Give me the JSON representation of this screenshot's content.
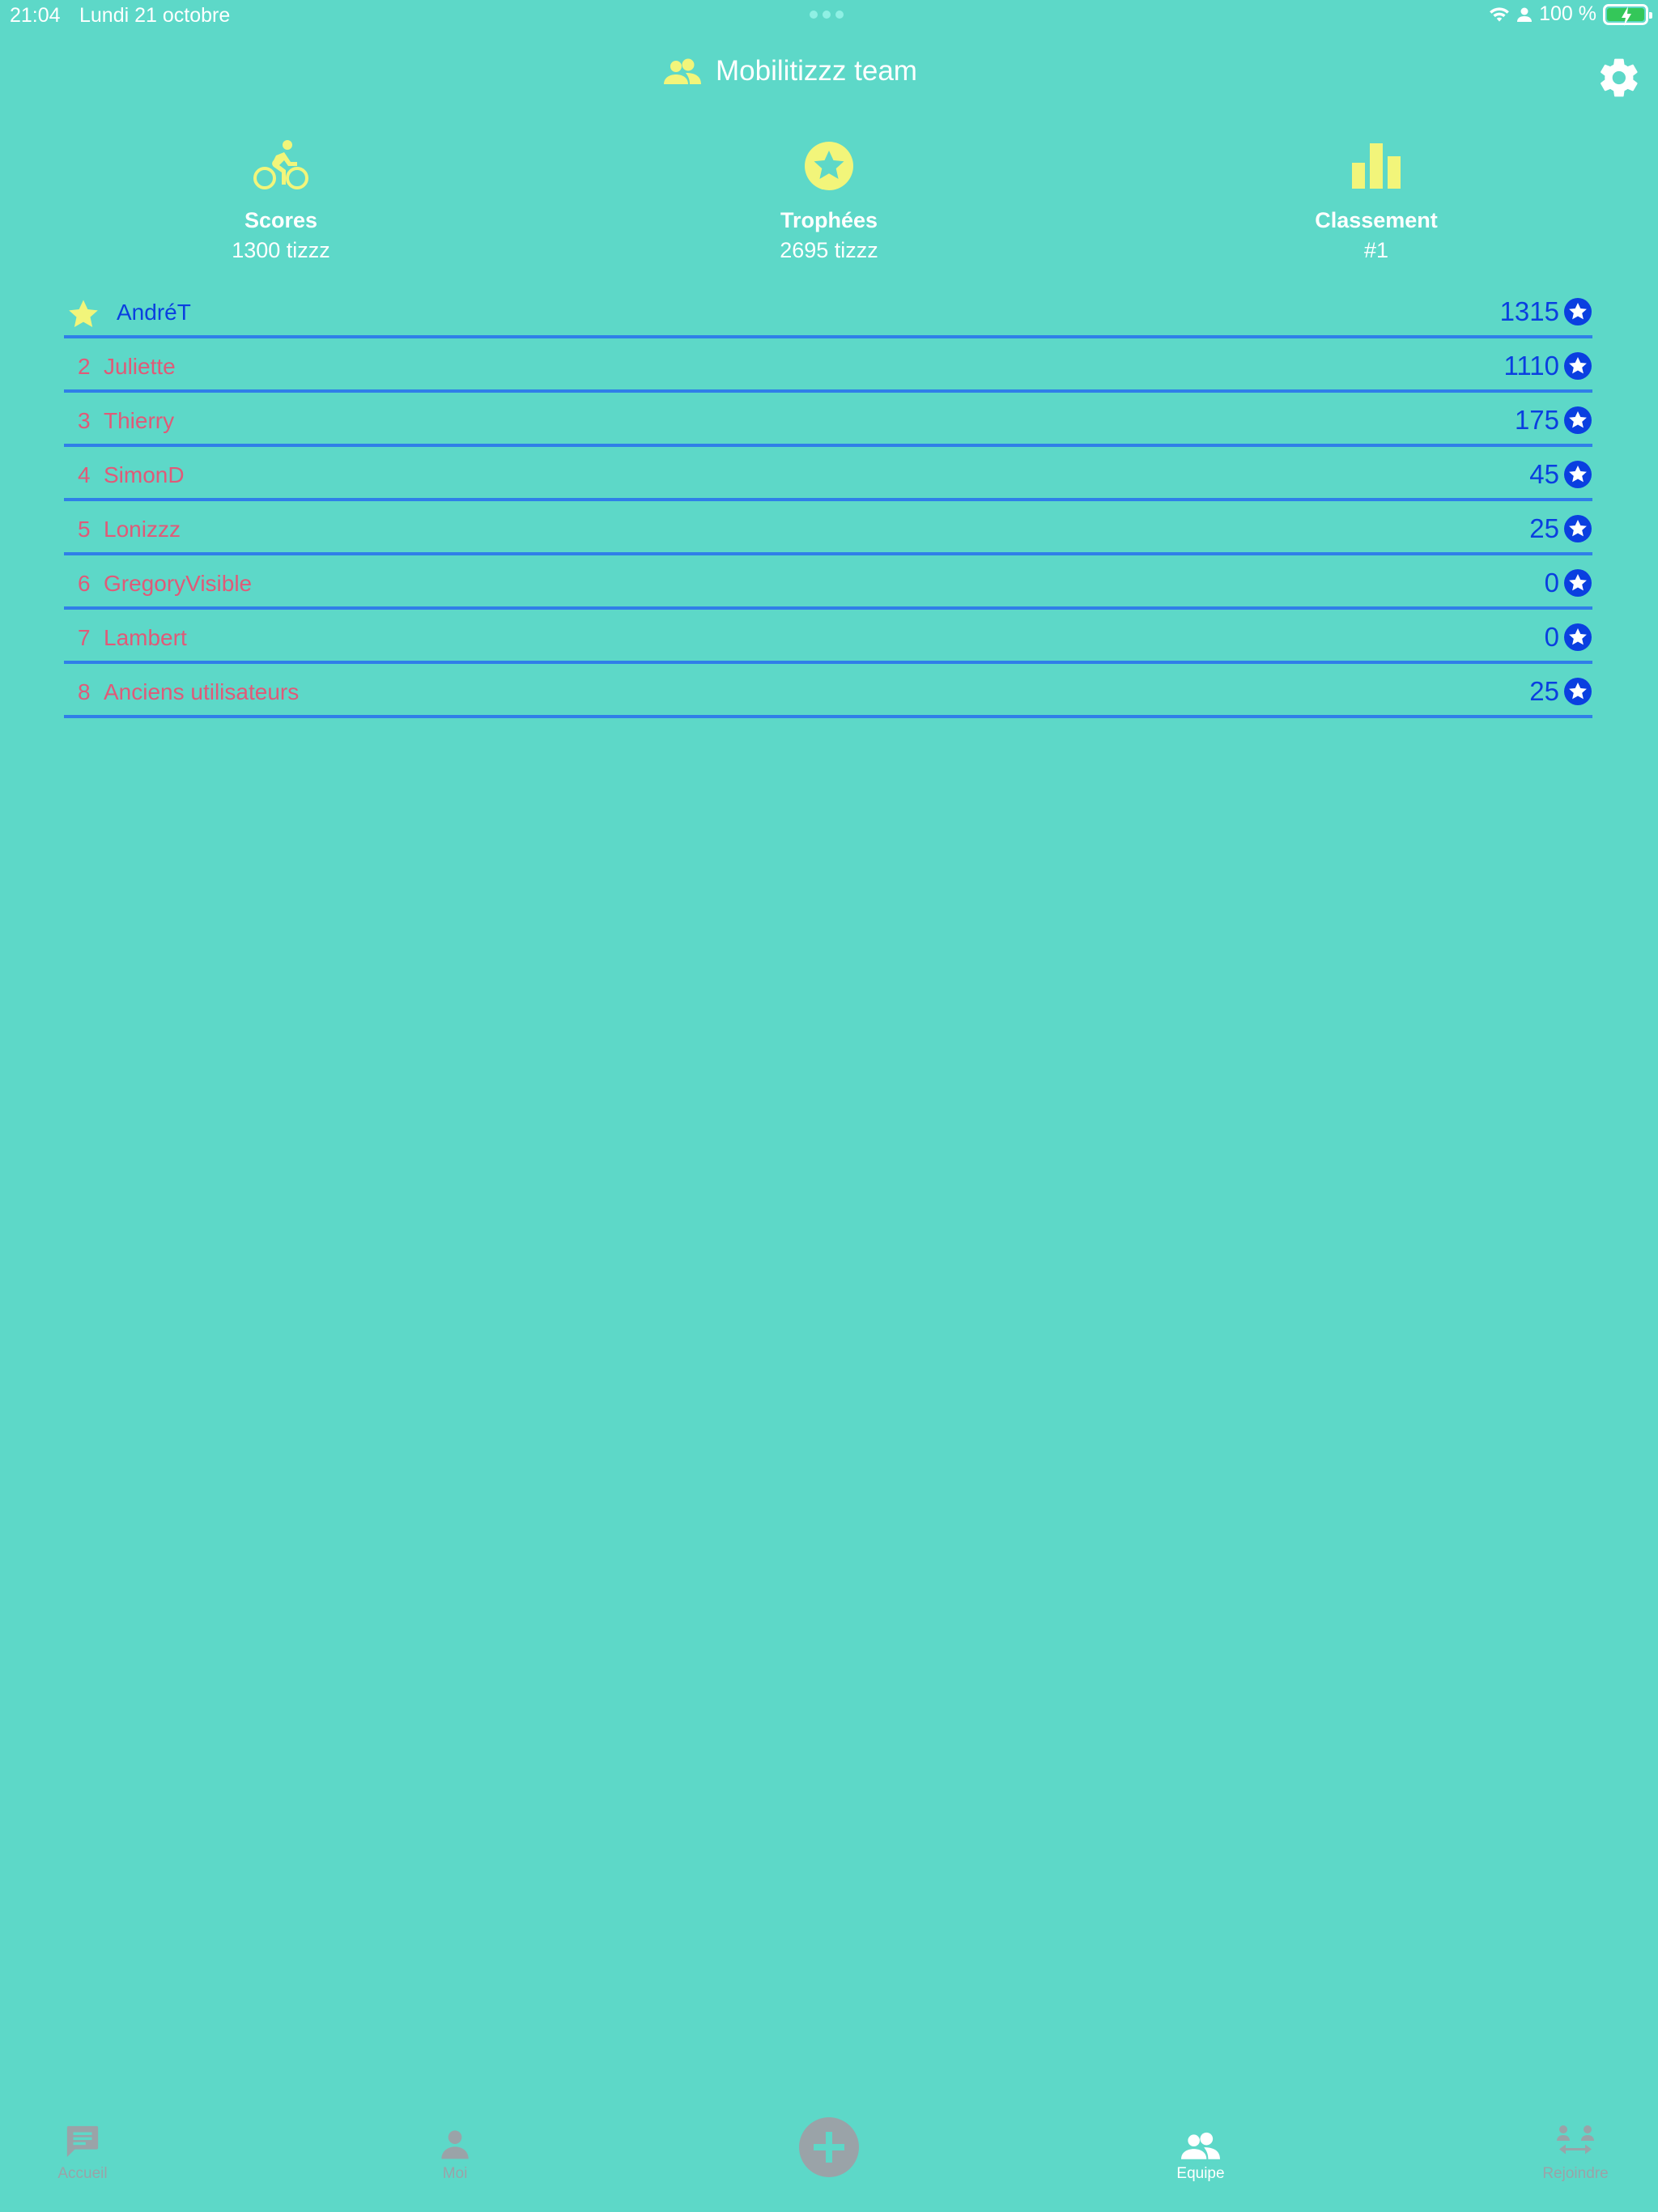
{
  "status_bar": {
    "time": "21:04",
    "date": "Lundi 21 octobre",
    "battery": "100 %"
  },
  "header": {
    "title": "Mobilitizzz team",
    "icon": "group-icon",
    "settings_icon": "gear-icon"
  },
  "stats": [
    {
      "label": "Scores",
      "value": "1300 tizzz",
      "icon": "bike-icon"
    },
    {
      "label": "Trophées",
      "value": "2695 tizzz",
      "icon": "star-badge-icon"
    },
    {
      "label": "Classement",
      "value": "#1",
      "icon": "bar-chart-icon"
    }
  ],
  "ranking": [
    {
      "rank": "",
      "name": "AndréT",
      "score": "1315",
      "is_me": true
    },
    {
      "rank": "2",
      "name": "Juliette",
      "score": "1110"
    },
    {
      "rank": "3",
      "name": "Thierry",
      "score": "175"
    },
    {
      "rank": "4",
      "name": "SimonD",
      "score": "45"
    },
    {
      "rank": "5",
      "name": "Lonizzz",
      "score": "25"
    },
    {
      "rank": "6",
      "name": "GregoryVisible",
      "score": "0"
    },
    {
      "rank": "7",
      "name": "Lambert",
      "score": "0"
    },
    {
      "rank": "8",
      "name": "Anciens utilisateurs",
      "score": "25"
    }
  ],
  "tabs": [
    {
      "label": "Accueil",
      "icon": "chat-icon",
      "active": false
    },
    {
      "label": "Moi",
      "icon": "person-icon",
      "active": false
    },
    {
      "label": "",
      "icon": "plus-icon",
      "active": false
    },
    {
      "label": "Equipe",
      "icon": "group-icon",
      "active": true
    },
    {
      "label": "Rejoindre",
      "icon": "join-icon",
      "active": false
    }
  ],
  "colors": {
    "background": "#5dd8c8",
    "accent_yellow": "#f2f57a",
    "score_blue": "#0a3fe0",
    "name_red": "#e05a78",
    "divider": "#2f7fe8",
    "tab_inactive": "#9aa3a8"
  }
}
